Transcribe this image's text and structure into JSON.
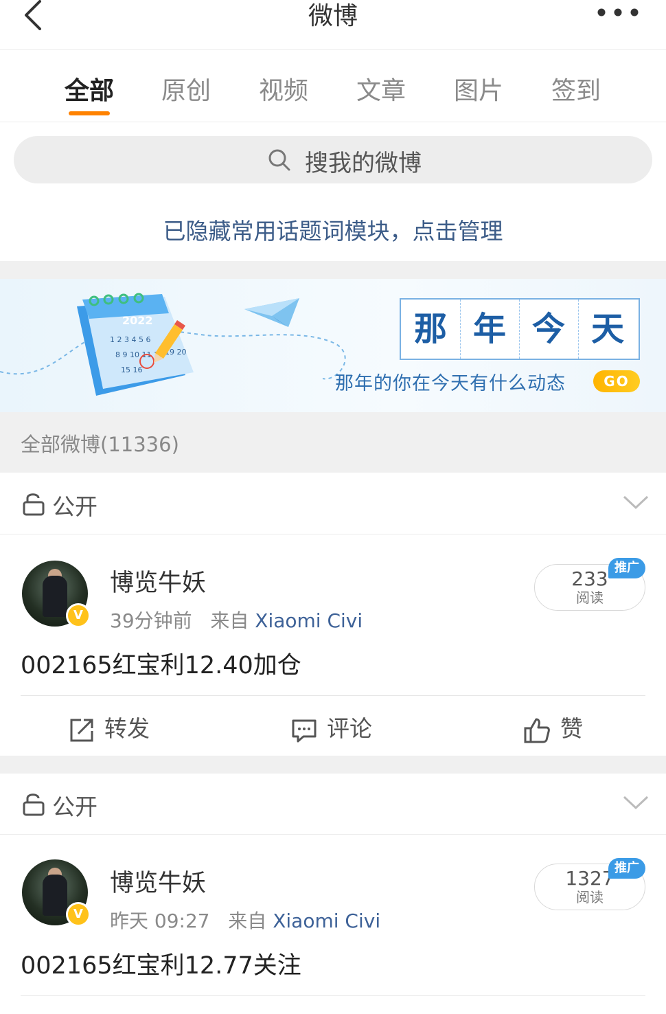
{
  "header": {
    "title": "微博"
  },
  "tabs": [
    {
      "label": "全部",
      "active": true
    },
    {
      "label": "原创",
      "active": false
    },
    {
      "label": "视频",
      "active": false
    },
    {
      "label": "文章",
      "active": false
    },
    {
      "label": "图片",
      "active": false
    },
    {
      "label": "签到",
      "active": false
    }
  ],
  "search": {
    "placeholder": "搜我的微博"
  },
  "topic_notice": "已隐藏常用话题词模块，点击管理",
  "banner": {
    "title_chars": [
      "那",
      "年",
      "今",
      "天"
    ],
    "calendar_year": "2022",
    "subtitle": "那年的你在今天有什么动态",
    "go_label": "GO"
  },
  "count_label": "全部微博(11336)",
  "posts": [
    {
      "visibility": "公开",
      "username": "博览牛妖",
      "time": "39分钟前",
      "source_prefix": "来自",
      "source": "Xiaomi Civi",
      "reads": "233",
      "reads_label": "阅读",
      "promo_label": "推广",
      "verified_mark": "V",
      "text": "002165红宝利12.40加仓",
      "actions": {
        "repost": "转发",
        "comment": "评论",
        "like": "赞"
      }
    },
    {
      "visibility": "公开",
      "username": "博览牛妖",
      "time": "昨天 09:27",
      "source_prefix": "来自",
      "source": "Xiaomi Civi",
      "reads": "1327",
      "reads_label": "阅读",
      "promo_label": "推广",
      "verified_mark": "V",
      "text": "002165红宝利12.77关注"
    }
  ],
  "colors": {
    "accent": "#ff8200",
    "link": "#3e6298",
    "promo": "#3b9be6",
    "verified": "#ffc21a"
  },
  "icons": [
    "back-icon",
    "more-icon",
    "search-icon",
    "lock-icon",
    "chevron-down-icon",
    "repost-icon",
    "comment-icon",
    "like-icon",
    "paper-plane-icon",
    "calendar-icon",
    "pencil-icon"
  ]
}
